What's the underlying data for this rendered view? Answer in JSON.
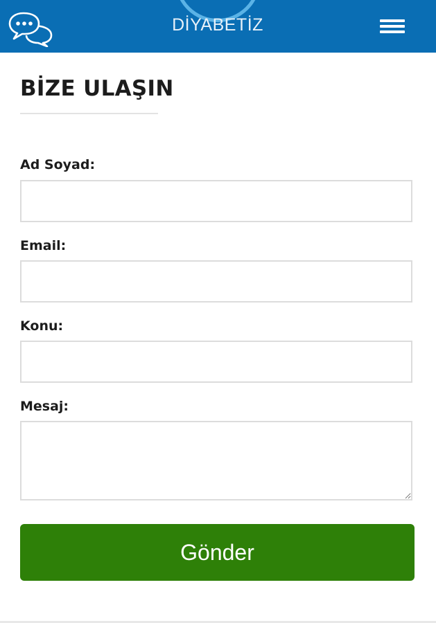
{
  "header": {
    "logo_text": "DİYABETİZ",
    "background_color": "#0a6eb4",
    "chat_icon": "chat-bubbles-icon",
    "menu_icon": "hamburger-menu-icon"
  },
  "page": {
    "title": "BİZE ULAŞIN"
  },
  "form": {
    "fields": [
      {
        "label": "Ad Soyad:",
        "value": "",
        "placeholder": ""
      },
      {
        "label": "Email:",
        "value": "",
        "placeholder": ""
      },
      {
        "label": "Konu:",
        "value": "",
        "placeholder": ""
      },
      {
        "label": "Mesaj:",
        "value": "",
        "placeholder": ""
      }
    ],
    "submit_label": "Gönder",
    "submit_color": "#2e8008"
  }
}
